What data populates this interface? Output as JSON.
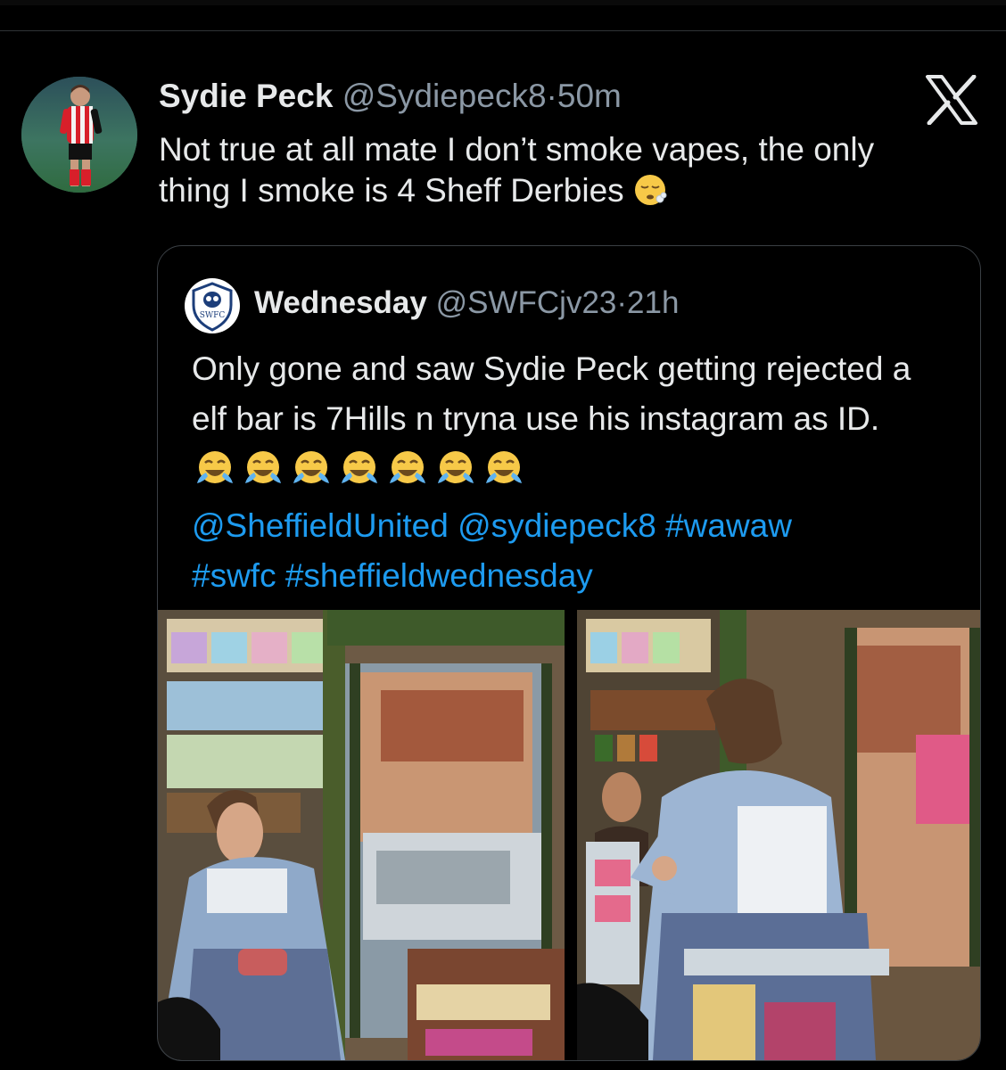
{
  "tweet": {
    "display_name": "Sydie Peck",
    "handle": "@Sydiepeck8",
    "separator": "·",
    "time": "50m",
    "text": "Not true at all mate I don’t smoke vapes, the only thing I smoke is 4 Sheff Derbies",
    "emoji": "face-exhaling-emoji"
  },
  "quote": {
    "display_name": "Wednesday",
    "handle": "@SWFCjv23",
    "separator": "·",
    "time": "21h",
    "avatar_text": "SWFC",
    "text": "Only gone and saw Sydie Peck getting rejected a elf bar is 7Hills n tryna use his instagram as ID.",
    "emoji_count": 7,
    "emoji": "tears-of-joy-emoji",
    "mentions": [
      "@SheffieldUnited",
      "@sydiepeck8"
    ],
    "hashtags": [
      "#wawaw",
      "#swfc",
      "#sheffieldwednesday"
    ]
  },
  "icons": {
    "x_logo": "x-logo-icon"
  },
  "colors": {
    "background": "#000000",
    "text": "#e7e9ea",
    "muted": "#8b98a5",
    "link": "#1d9bf0"
  }
}
